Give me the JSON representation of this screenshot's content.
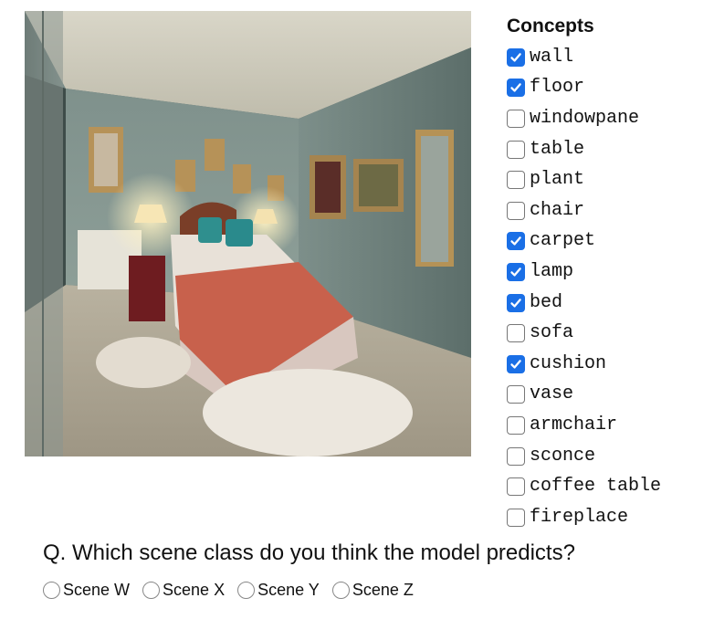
{
  "concepts": {
    "title": "Concepts",
    "items": [
      {
        "label": "wall",
        "checked": true
      },
      {
        "label": "floor",
        "checked": true
      },
      {
        "label": "windowpane",
        "checked": false
      },
      {
        "label": "table",
        "checked": false
      },
      {
        "label": "plant",
        "checked": false
      },
      {
        "label": "chair",
        "checked": false
      },
      {
        "label": "carpet",
        "checked": true
      },
      {
        "label": "lamp",
        "checked": true
      },
      {
        "label": "bed",
        "checked": true
      },
      {
        "label": "sofa",
        "checked": false
      },
      {
        "label": "cushion",
        "checked": true
      },
      {
        "label": "vase",
        "checked": false
      },
      {
        "label": "armchair",
        "checked": false
      },
      {
        "label": "sconce",
        "checked": false
      },
      {
        "label": "coffee table",
        "checked": false
      },
      {
        "label": "fireplace",
        "checked": false
      }
    ]
  },
  "question": {
    "text": "Q. Which scene class do you think the model predicts?",
    "options": [
      "Scene W",
      "Scene X",
      "Scene Y",
      "Scene Z"
    ]
  },
  "colors": {
    "checkbox_checked": "#1a6fe6",
    "text": "#111111"
  },
  "icons": {
    "checked": "checkmark-icon"
  }
}
